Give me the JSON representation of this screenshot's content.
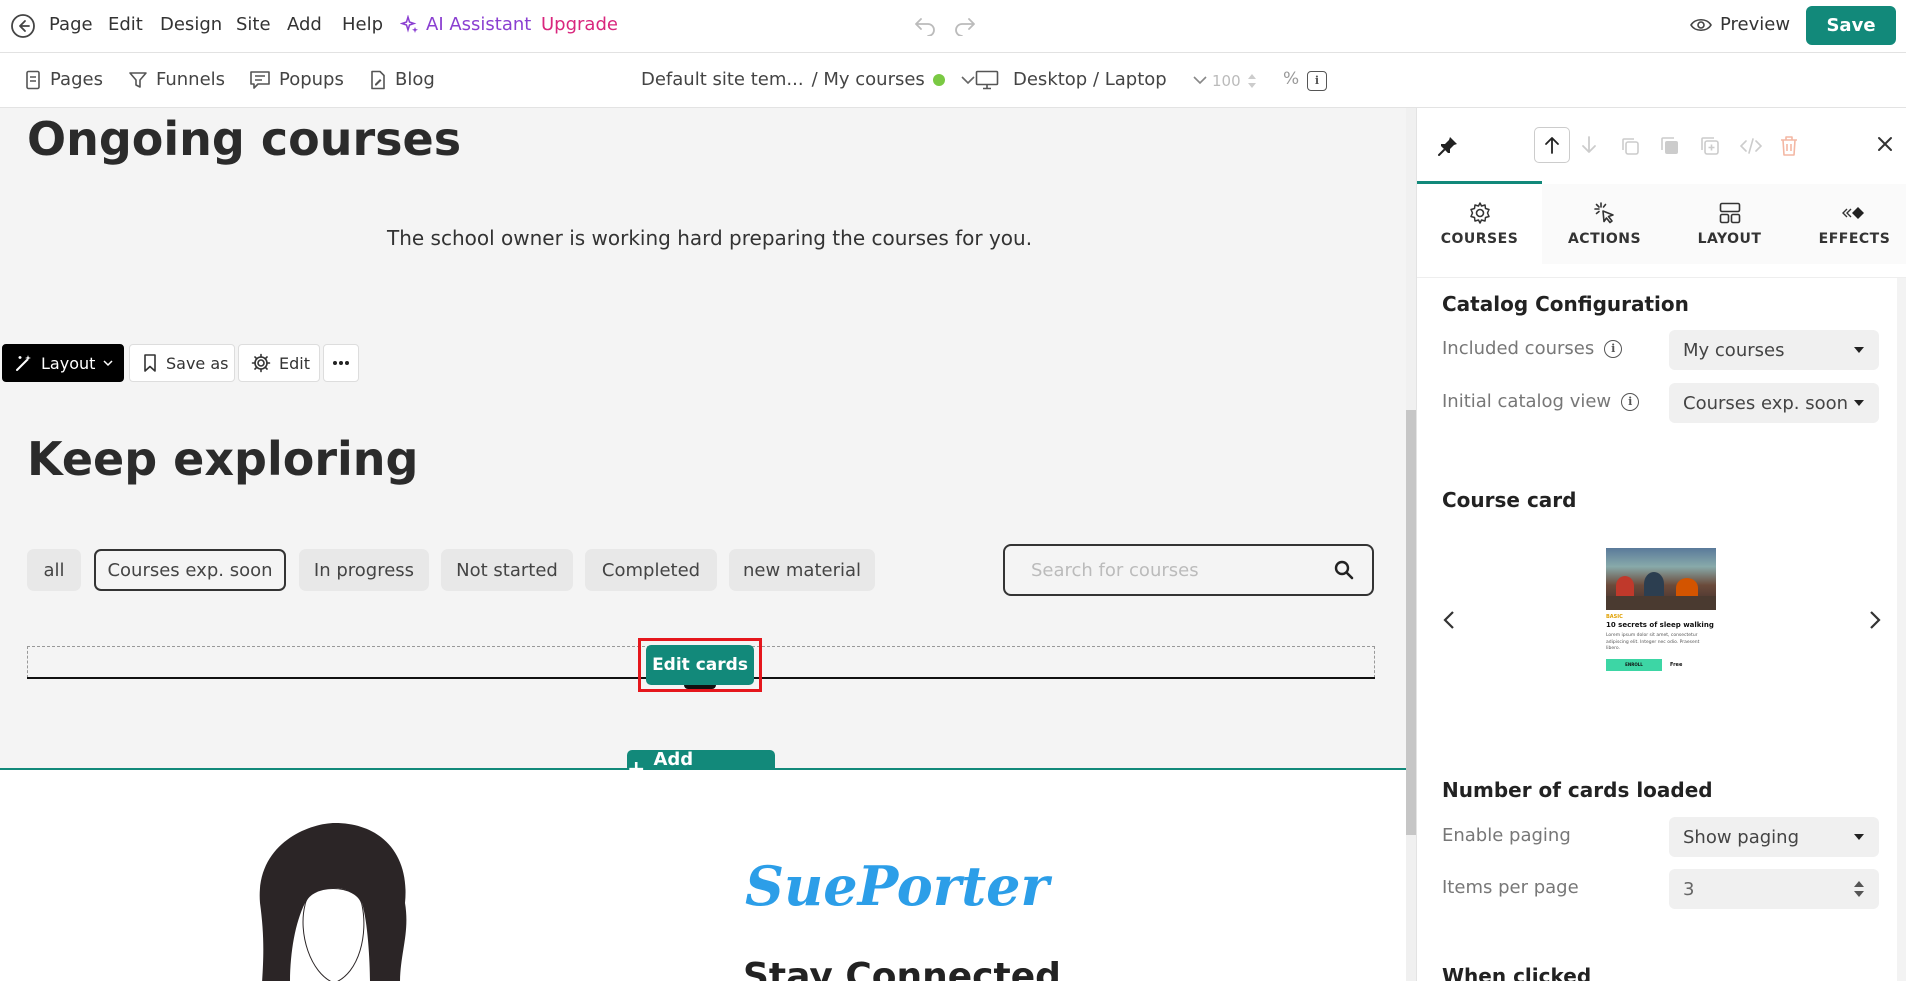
{
  "topbar": {
    "menu": [
      "Page",
      "Edit",
      "Design",
      "Site",
      "Add",
      "Help"
    ],
    "ai_assistant": "AI Assistant",
    "upgrade": "Upgrade",
    "preview": "Preview",
    "save": "Save"
  },
  "secondbar": {
    "nav": [
      "Pages",
      "Funnels",
      "Popups",
      "Blog"
    ],
    "template": "Default site tem...",
    "page": "/ My courses",
    "device": "Desktop / Laptop",
    "zoom": "100",
    "zoom_unit": "%"
  },
  "canvas": {
    "title_ongoing": "Ongoing courses",
    "ongoing_message": "The school owner is working hard preparing the courses for you.",
    "toolbar": {
      "layout": "Layout",
      "save_as": "Save as",
      "edit": "Edit"
    },
    "title_explore": "Keep exploring",
    "filters": [
      "all",
      "Courses exp. soon",
      "In progress",
      "Not started",
      "Completed",
      "new material"
    ],
    "active_filter": "Courses exp. soon",
    "search_placeholder": "Search for courses",
    "edit_cards": "Edit cards",
    "add_section": "Add Section",
    "brand": "SuePorter",
    "stay_connected": "Stay Connected"
  },
  "panel": {
    "tabs": [
      "COURSES",
      "ACTIONS",
      "LAYOUT",
      "EFFECTS"
    ],
    "catalog_title": "Catalog Configuration",
    "included_label": "Included courses",
    "included_value": "My courses",
    "initial_label": "Initial catalog view",
    "initial_value": "Courses exp. soon",
    "card_title": "Course card",
    "card_preview": {
      "tag": "BASIC",
      "title": "10 secrets of sleep walking",
      "body": "Lorem ipsum dolor sit amet, consectetur adipiscing elit. Integer nec odio. Praesent libero.",
      "button": "ENROLL",
      "price": "Free"
    },
    "cards_loaded_title": "Number of cards loaded",
    "paging_label": "Enable paging",
    "paging_value": "Show paging",
    "items_label": "Items per page",
    "items_value": "3",
    "clipped_heading": "When clicked"
  },
  "colors": {
    "primary": "#12897a",
    "ai": "#8a3fd1",
    "upgrade": "#d9267d",
    "brand": "#2c9ee8",
    "highlight": "#e5161c"
  }
}
